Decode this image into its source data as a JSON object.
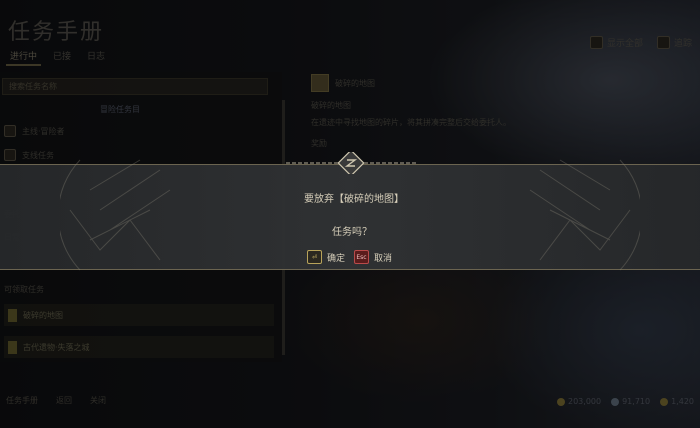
{
  "screen": {
    "title": "任务手册"
  },
  "tabs": [
    {
      "label": "进行中"
    },
    {
      "label": "已接"
    },
    {
      "label": "日志"
    }
  ],
  "top_buttons": [
    {
      "label": "显示全部"
    },
    {
      "label": "追踪"
    }
  ],
  "left": {
    "search_text": "搜索任务名称",
    "category_header": "冒险任务目",
    "rows": [
      "主线·冒险者",
      "支线任务",
      "委托",
      "日常"
    ],
    "section": "可领取任务",
    "quests": [
      {
        "label": "破碎的地图"
      },
      {
        "label": "古代遗物·失落之城"
      }
    ]
  },
  "right": {
    "header": "破碎的地图",
    "subheader": "破碎的地图",
    "desc": "在遗迹中寻找地图的碎片，将其拼凑完整后交给委托人。",
    "extra": "奖励"
  },
  "bottom": {
    "left_items": [
      "任务手册",
      "返回",
      "关闭"
    ],
    "currency": [
      "203,000",
      "91,710",
      "1,420"
    ]
  },
  "dialog": {
    "line1": "要放弃【破碎的地图】",
    "line2": "任务吗？",
    "confirm_label": "确定",
    "confirm_key": "⏎",
    "cancel_label": "取消",
    "cancel_key": "Esc"
  }
}
